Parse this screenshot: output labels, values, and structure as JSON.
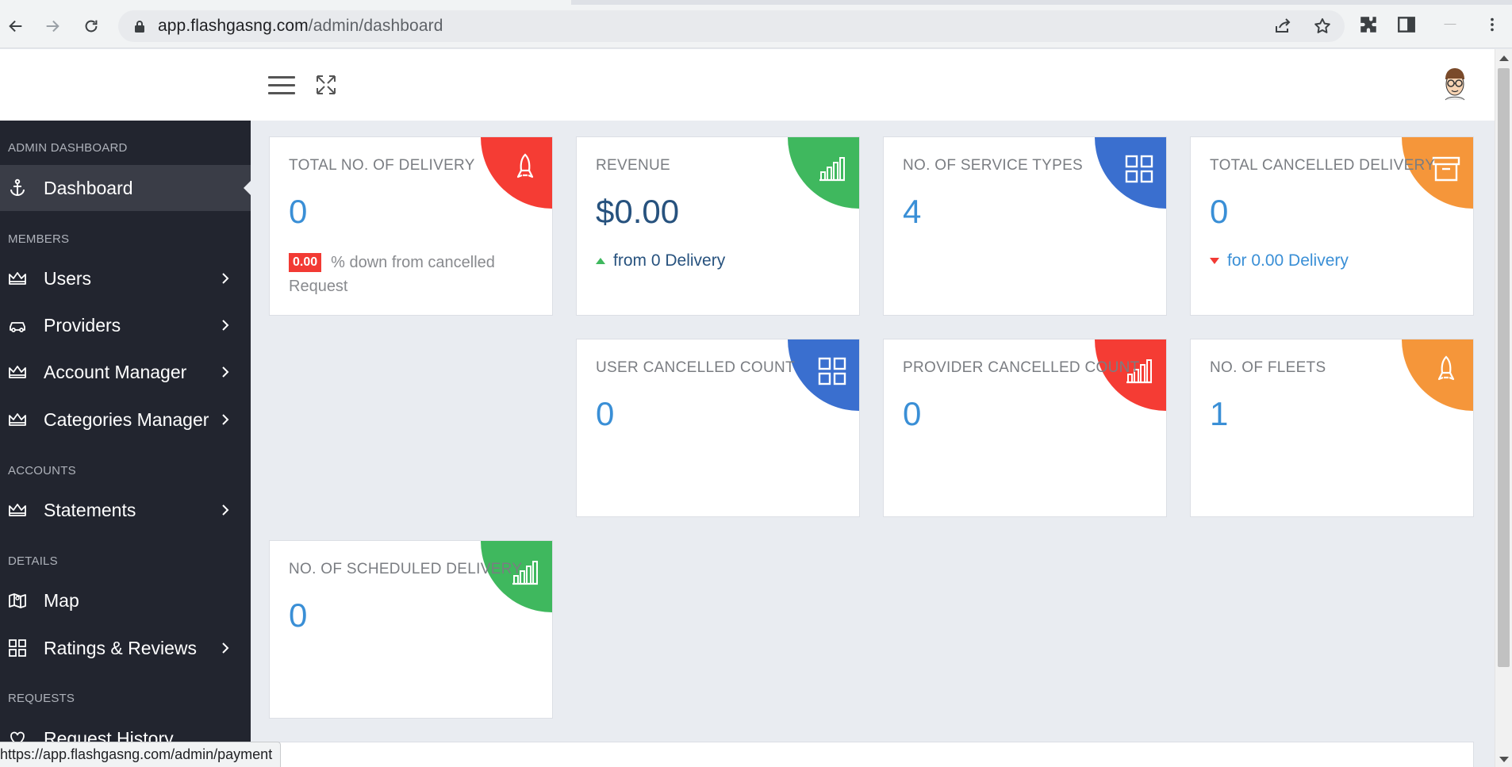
{
  "browser": {
    "url_host": "app.flashgasng.com",
    "url_path": "/admin/dashboard",
    "status_url": "https://app.flashgasng.com/admin/payment"
  },
  "sidebar": {
    "sections": {
      "admin": "ADMIN DASHBOARD",
      "members": "MEMBERS",
      "accounts": "ACCOUNTS",
      "details": "DETAILS",
      "requests": "REQUESTS"
    },
    "items": {
      "dashboard": "Dashboard",
      "users": "Users",
      "providers": "Providers",
      "account_manager": "Account Manager",
      "categories_manager": "Categories Manager",
      "statements": "Statements",
      "map": "Map",
      "ratings": "Ratings & Reviews",
      "request_history": "Request History"
    }
  },
  "cards": {
    "total_delivery": {
      "title": "TOTAL NO. OF DELIVERY",
      "value": "0",
      "badge": "0.00",
      "sub": "% down from cancelled Request",
      "color": "#f53c34",
      "icon": "rocket-icon"
    },
    "revenue": {
      "title": "REVENUE",
      "value": "$0.00",
      "trend": "from 0 Delivery",
      "color": "#3fb85e",
      "icon": "bar-chart-icon"
    },
    "service_types": {
      "title": "NO. OF SERVICE TYPES",
      "value": "4",
      "color": "#3a6fcf",
      "icon": "grid-icon"
    },
    "cancelled_delivery": {
      "title": "TOTAL CANCELLED DELIVERY",
      "value": "0",
      "trend": "for 0.00 Delivery",
      "color": "#f5963a",
      "icon": "archive-icon"
    },
    "user_cancelled": {
      "title": "USER CANCELLED COUNT",
      "value": "0",
      "color": "#3a6fcf",
      "icon": "grid-icon"
    },
    "provider_cancelled": {
      "title": "PROVIDER CANCELLED COUNT",
      "value": "0",
      "color": "#f53c34",
      "icon": "bar-chart-icon"
    },
    "fleets": {
      "title": "NO. OF FLEETS",
      "value": "1",
      "color": "#f5963a",
      "icon": "rocket-icon"
    },
    "scheduled_delivery": {
      "title": "NO. OF SCHEDULED DELIVERY",
      "value": "0",
      "color": "#3fb85e",
      "icon": "bar-chart-icon"
    }
  }
}
